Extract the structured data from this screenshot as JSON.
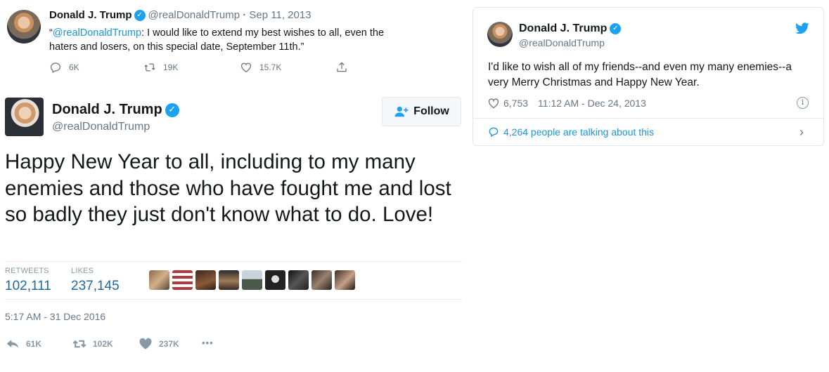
{
  "tweet1": {
    "name": "Donald J. Trump",
    "handle": "@realDonaldTrump",
    "date": "Sep 11, 2013",
    "quote_open": "“",
    "mention": "@realDonaldTrump",
    "text": ": I would like to extend my best wishes to all, even the haters and losers, on this special date, September 11th.”",
    "replies": "6K",
    "retweets": "19K",
    "likes": "15.7K"
  },
  "tweet2": {
    "name": "Donald J. Trump",
    "handle": "@realDonaldTrump",
    "follow_label": "Follow",
    "text": "Happy New Year to all, including to my many enemies and those who have fought me and lost so badly they just don't know what to do. Love!",
    "retweets_label": "RETWEETS",
    "retweets_value": "102,111",
    "likes_label": "LIKES",
    "likes_value": "237,145",
    "timestamp": "5:17 AM - 31 Dec 2016",
    "reply_count": "61K",
    "retweet_count": "102K",
    "like_count": "237K",
    "more": "•••"
  },
  "tweet3": {
    "name": "Donald J. Trump",
    "handle": "@realDonaldTrump",
    "text": "I'd like to wish all of my friends--and even my many enemies--a very Merry Christmas and Happy New Year.",
    "likes": "6,753",
    "timestamp": "11:12 AM - Dec 24, 2013",
    "talking": "4,264 people are talking about this"
  },
  "icons": {
    "verified": "verified-badge-icon",
    "reply": "reply-icon",
    "retweet": "retweet-icon",
    "like": "heart-icon",
    "share": "share-icon",
    "twitter": "twitter-bird-icon",
    "info": "info-icon",
    "comment": "comment-bubble-icon",
    "follow": "follow-person-plus-icon",
    "more": "more-dots-icon"
  },
  "colors": {
    "brand_blue": "#1da1f2",
    "link_blue": "#1b95e0",
    "muted": "#657786",
    "stat_blue": "#1c6a9c"
  }
}
